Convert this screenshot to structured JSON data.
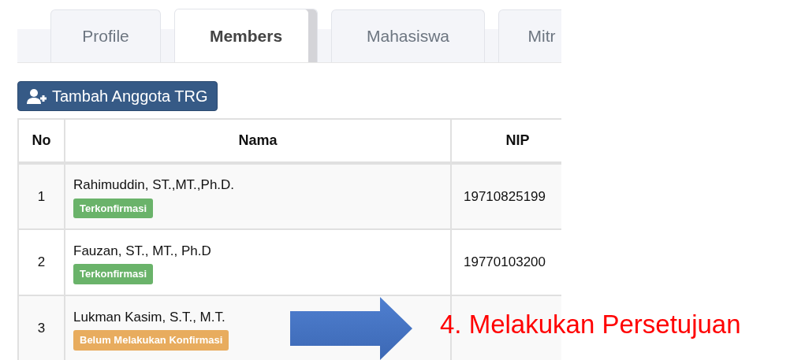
{
  "tabs": [
    {
      "label": "Profile",
      "selected": false
    },
    {
      "label": "Members",
      "selected": true
    },
    {
      "label": "Mahasiswa",
      "selected": false
    },
    {
      "label": "Mitr",
      "selected": false
    }
  ],
  "add_button": {
    "label": "Tambah Anggota TRG"
  },
  "table": {
    "columns": [
      "No",
      "Nama",
      "NIP"
    ],
    "rows": [
      {
        "no": "1",
        "nama": "Rahimuddin, ST.,MT.,Ph.D.",
        "status": {
          "kind": "confirmed",
          "label": "Terkonfirmasi"
        },
        "nip": "19710825199"
      },
      {
        "no": "2",
        "nama": "Fauzan, ST., MT., Ph.D",
        "status": {
          "kind": "confirmed",
          "label": "Terkonfirmasi"
        },
        "nip": "19770103200"
      },
      {
        "no": "3",
        "nama": "Lukman Kasim, S.T., M.T.",
        "status": {
          "kind": "pending",
          "label": "Belum Melakukan Konfirmasi"
        }
      }
    ]
  },
  "annotation": {
    "text": "4. Melakukan Persetujuan"
  }
}
